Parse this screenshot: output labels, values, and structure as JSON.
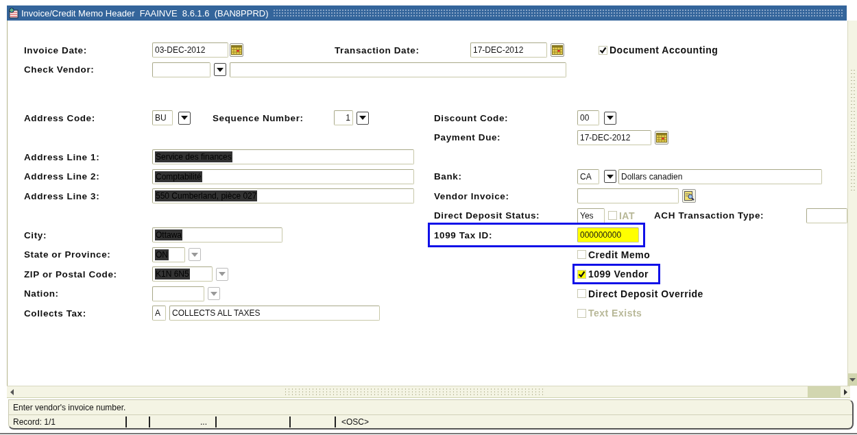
{
  "window": {
    "title": "Invoice/Credit Memo Header  FAAINVE  8.6.1.6  (BAN8PPRD)"
  },
  "top_rows": [
    {
      "label": "Invoice Date:",
      "items": [
        {
          "kind": "field",
          "value": "03-DEC-2012"
        },
        {
          "kind": "calendar"
        },
        {
          "kind": "text",
          "text": "Transaction Date:"
        },
        {
          "kind": "field",
          "value": "17-DEC-2012"
        },
        {
          "kind": "calendar"
        },
        {
          "kind": "checkbox",
          "label": "Document Accounting",
          "checked": true,
          "disabled": false
        }
      ]
    },
    {
      "label": "Check Vendor:",
      "items": [
        {
          "kind": "field"
        },
        {
          "kind": "dropdown",
          "disabled": false
        },
        {
          "kind": "field"
        }
      ]
    }
  ],
  "left_groups": [
    [
      {
        "label": "Address Code:",
        "items": [
          {
            "kind": "field",
            "value": "BU"
          },
          {
            "kind": "dropdown",
            "disabled": false
          },
          {
            "kind": "text",
            "text": "Sequence Number:"
          },
          {
            "kind": "number",
            "value": "1"
          },
          {
            "kind": "dropdown",
            "disabled": false
          }
        ]
      }
    ],
    [
      {
        "label": "Address Line 1:",
        "items": [
          {
            "kind": "field",
            "value": "Service des finances",
            "highlighted": true
          }
        ]
      },
      {
        "label": "Address Line 2:",
        "items": [
          {
            "kind": "field",
            "value": "Comptabilité",
            "highlighted": true
          }
        ]
      },
      {
        "label": "Address Line 3:",
        "items": [
          {
            "kind": "field",
            "value": "550 Cumberland, pièce 027",
            "highlighted": true
          }
        ]
      }
    ],
    [
      {
        "label": "City:",
        "items": [
          {
            "kind": "field",
            "value": "Ottawa",
            "highlighted": true
          }
        ]
      },
      {
        "label": "State or Province:",
        "items": [
          {
            "kind": "field",
            "value": "ON",
            "highlighted": true
          },
          {
            "kind": "dropdown",
            "disabled": true
          }
        ]
      },
      {
        "label": "ZIP or Postal Code:",
        "items": [
          {
            "kind": "field",
            "value": "K1N 6N5",
            "highlighted": true
          },
          {
            "kind": "dropdown",
            "disabled": true
          }
        ]
      },
      {
        "label": "Nation:",
        "items": [
          {
            "kind": "field"
          },
          {
            "kind": "dropdown",
            "disabled": true
          }
        ]
      },
      {
        "label": "Collects Tax:",
        "items": [
          {
            "kind": "field",
            "value": "A"
          },
          {
            "kind": "field",
            "value": "COLLECTS ALL TAXES"
          }
        ]
      }
    ]
  ],
  "right_groups": [
    [
      {
        "label": "Discount Code:",
        "items": [
          {
            "kind": "field",
            "value": "00"
          },
          {
            "kind": "dropdown",
            "disabled": false
          }
        ]
      },
      {
        "label": "Payment Due:",
        "items": [
          {
            "kind": "field",
            "value": "17-DEC-2012"
          },
          {
            "kind": "calendar"
          }
        ]
      }
    ],
    [
      {
        "label": "Bank:",
        "items": [
          {
            "kind": "field",
            "value": "CA"
          },
          {
            "kind": "dropdown",
            "disabled": false
          },
          {
            "kind": "field",
            "value": "Dollars canadien"
          }
        ]
      },
      {
        "label": "Vendor Invoice:",
        "items": [
          {
            "kind": "field"
          },
          {
            "kind": "lookup"
          }
        ]
      },
      {
        "label": "Direct Deposit Status:",
        "items": [
          {
            "kind": "field",
            "value": "Yes"
          },
          {
            "kind": "checkbox",
            "label": "IAT",
            "checked": false,
            "disabled": true
          },
          {
            "kind": "text",
            "text": "ACH Transaction Type:"
          },
          {
            "kind": "field"
          }
        ]
      },
      {
        "label": "1099 Tax ID:",
        "outlined": true,
        "items": [
          {
            "kind": "field",
            "value": "000000000",
            "current": true
          }
        ]
      },
      {
        "items": [
          {
            "kind": "checkbox",
            "label": "Credit Memo",
            "checked": false,
            "disabled": false
          }
        ]
      },
      {
        "items": [
          {
            "kind": "checkbox",
            "label": "1099 Vendor",
            "checked": true,
            "disabled": false,
            "current": true,
            "outlined": true
          }
        ]
      },
      {
        "items": [
          {
            "kind": "checkbox",
            "label": "Direct Deposit Override",
            "checked": false,
            "disabled": false
          }
        ]
      },
      {
        "items": [
          {
            "kind": "checkbox",
            "label": "Text Exists",
            "checked": false,
            "disabled": true
          }
        ]
      }
    ]
  ],
  "status_bar": {
    "message": "Enter vendor's invoice number.",
    "record": "Record: 1/1",
    "indicator": "...",
    "mode": "<OSC>"
  }
}
